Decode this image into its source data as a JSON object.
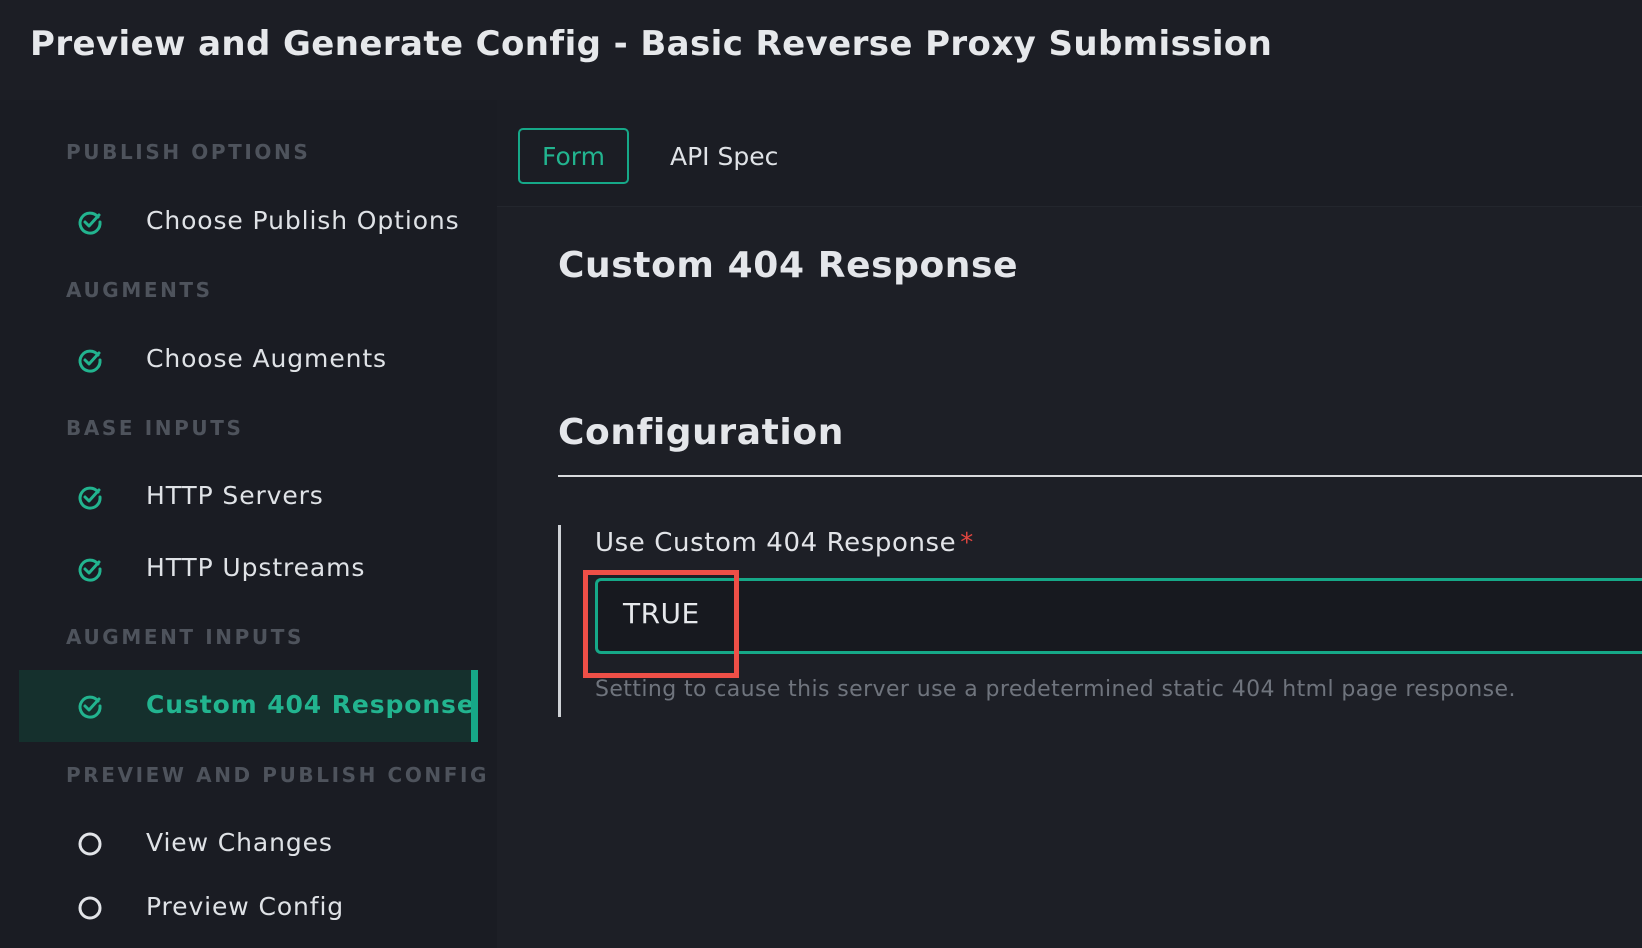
{
  "header": {
    "title": "Preview and Generate Config - Basic Reverse Proxy Submission"
  },
  "sidebar": {
    "sections": [
      {
        "label": "PUBLISH OPTIONS"
      },
      {
        "label": "AUGMENTS"
      },
      {
        "label": "BASE INPUTS"
      },
      {
        "label": "AUGMENT INPUTS"
      },
      {
        "label": "PREVIEW AND PUBLISH CONFIG"
      }
    ],
    "items": [
      {
        "label": "Choose Publish Options",
        "status": "complete",
        "icon": "check-circle-icon"
      },
      {
        "label": "Choose Augments",
        "status": "complete",
        "icon": "check-circle-icon"
      },
      {
        "label": "HTTP Servers",
        "status": "complete",
        "icon": "check-circle-icon"
      },
      {
        "label": "HTTP Upstreams",
        "status": "complete",
        "icon": "check-circle-icon"
      },
      {
        "label": "Custom 404 Response",
        "status": "complete",
        "active": true,
        "icon": "check-circle-icon"
      },
      {
        "label": "View Changes",
        "status": "pending",
        "icon": "empty-circle-icon"
      },
      {
        "label": "Preview Config",
        "status": "pending",
        "icon": "empty-circle-icon"
      }
    ]
  },
  "tabs": [
    {
      "label": "Form",
      "selected": true
    },
    {
      "label": "API Spec",
      "selected": false
    }
  ],
  "main": {
    "section_title": "Custom 404 Response",
    "config_title": "Configuration",
    "field": {
      "label": "Use Custom 404 Response",
      "required_mark": "*",
      "value": "TRUE",
      "help": "Setting to cause this server use a predetermined static 404 html page response."
    }
  },
  "colors": {
    "accent": "#16a888",
    "accent_text": "#22b48f",
    "highlight": "#ee4f47",
    "required": "#e0453f",
    "background": "#1b1d24"
  }
}
